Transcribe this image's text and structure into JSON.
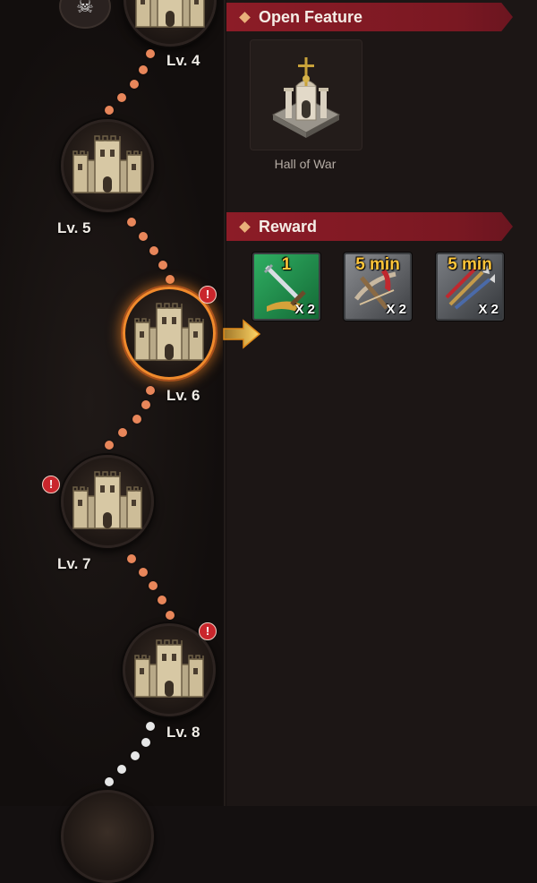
{
  "levels": [
    {
      "label": "Lv. 4"
    },
    {
      "label": "Lv. 5"
    },
    {
      "label": "Lv. 6"
    },
    {
      "label": "Lv. 7"
    },
    {
      "label": "Lv. 8"
    }
  ],
  "alert_mark": "!",
  "open_feature": {
    "title": "Open Feature",
    "item": {
      "label": "Hall of War",
      "icon": "hall-of-war-icon"
    }
  },
  "reward": {
    "title": "Reward",
    "items": [
      {
        "amount": "1",
        "quantity": "X 2",
        "icon": "sword-banner-icon",
        "color": "#1e8a4a"
      },
      {
        "amount": "5 min",
        "quantity": "X 2",
        "icon": "crossbow-speedup-icon",
        "color": "#6b6d70"
      },
      {
        "amount": "5 min",
        "quantity": "X 2",
        "icon": "arrows-speedup-icon",
        "color": "#5d6064"
      }
    ]
  },
  "colors": {
    "path_dot_done": "#e8865a",
    "path_dot_locked": "#e6e6e6",
    "header": "#8c1c27",
    "active_ring": "#f08a2c"
  }
}
